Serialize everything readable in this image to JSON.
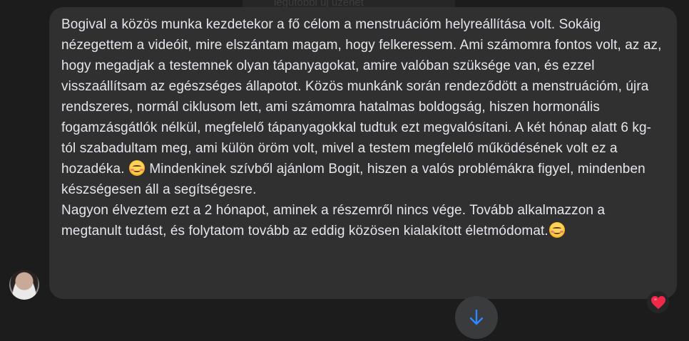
{
  "header": {
    "ghost_text": "legutóbbi új üzenet"
  },
  "message": {
    "paragraph1_part1": "Bogival a közös munka kezdetekor a fő célom a menstruációm helyreállítása volt. Sokáig nézegettem a videóit, mire elszántam magam, hogy felkeressem. Ami számomra fontos volt, az az, hogy megadjak a testemnek olyan tápanyagokat, amire valóban szüksége van, és ezzel visszaállítsam az egészséges állapotot. Közös munkánk során rendeződött a menstruációm, újra rendszeres, normál ciklusom lett, ami számomra hatalmas boldogság, hiszen hormonális fogamzásgátlók nélkül, megfelelő tápanyagokkal tudtuk ezt megvalósítani. A két hónap alatt 6 kg- tól szabadultam meg, ami külön öröm volt, mivel a testem megfelelő működésének volt ez a hozadéka.",
    "paragraph1_part2": " Mindenkinek szívből ajánlom Bogit, hiszen a valós problémákra figyel, mindenben készségesen áll a segítségesre.",
    "paragraph2": "Nagyon élveztem ezt a 2 hónapot, aminek a részemről nincs vége. Tovább alkalmazzon a megtanult tudást, és folytatom tovább az eddig közösen kialakított életmódomat.",
    "emoji": "smiling-face-with-smiling-eyes"
  },
  "reaction": {
    "icon": "heart-icon",
    "color": "#f02849"
  },
  "scroll_button": {
    "icon": "arrow-down-icon",
    "color": "#2d88ff"
  },
  "colors": {
    "background": "#1c1c1d",
    "bubble": "#303031",
    "text": "#e4e6eb"
  }
}
